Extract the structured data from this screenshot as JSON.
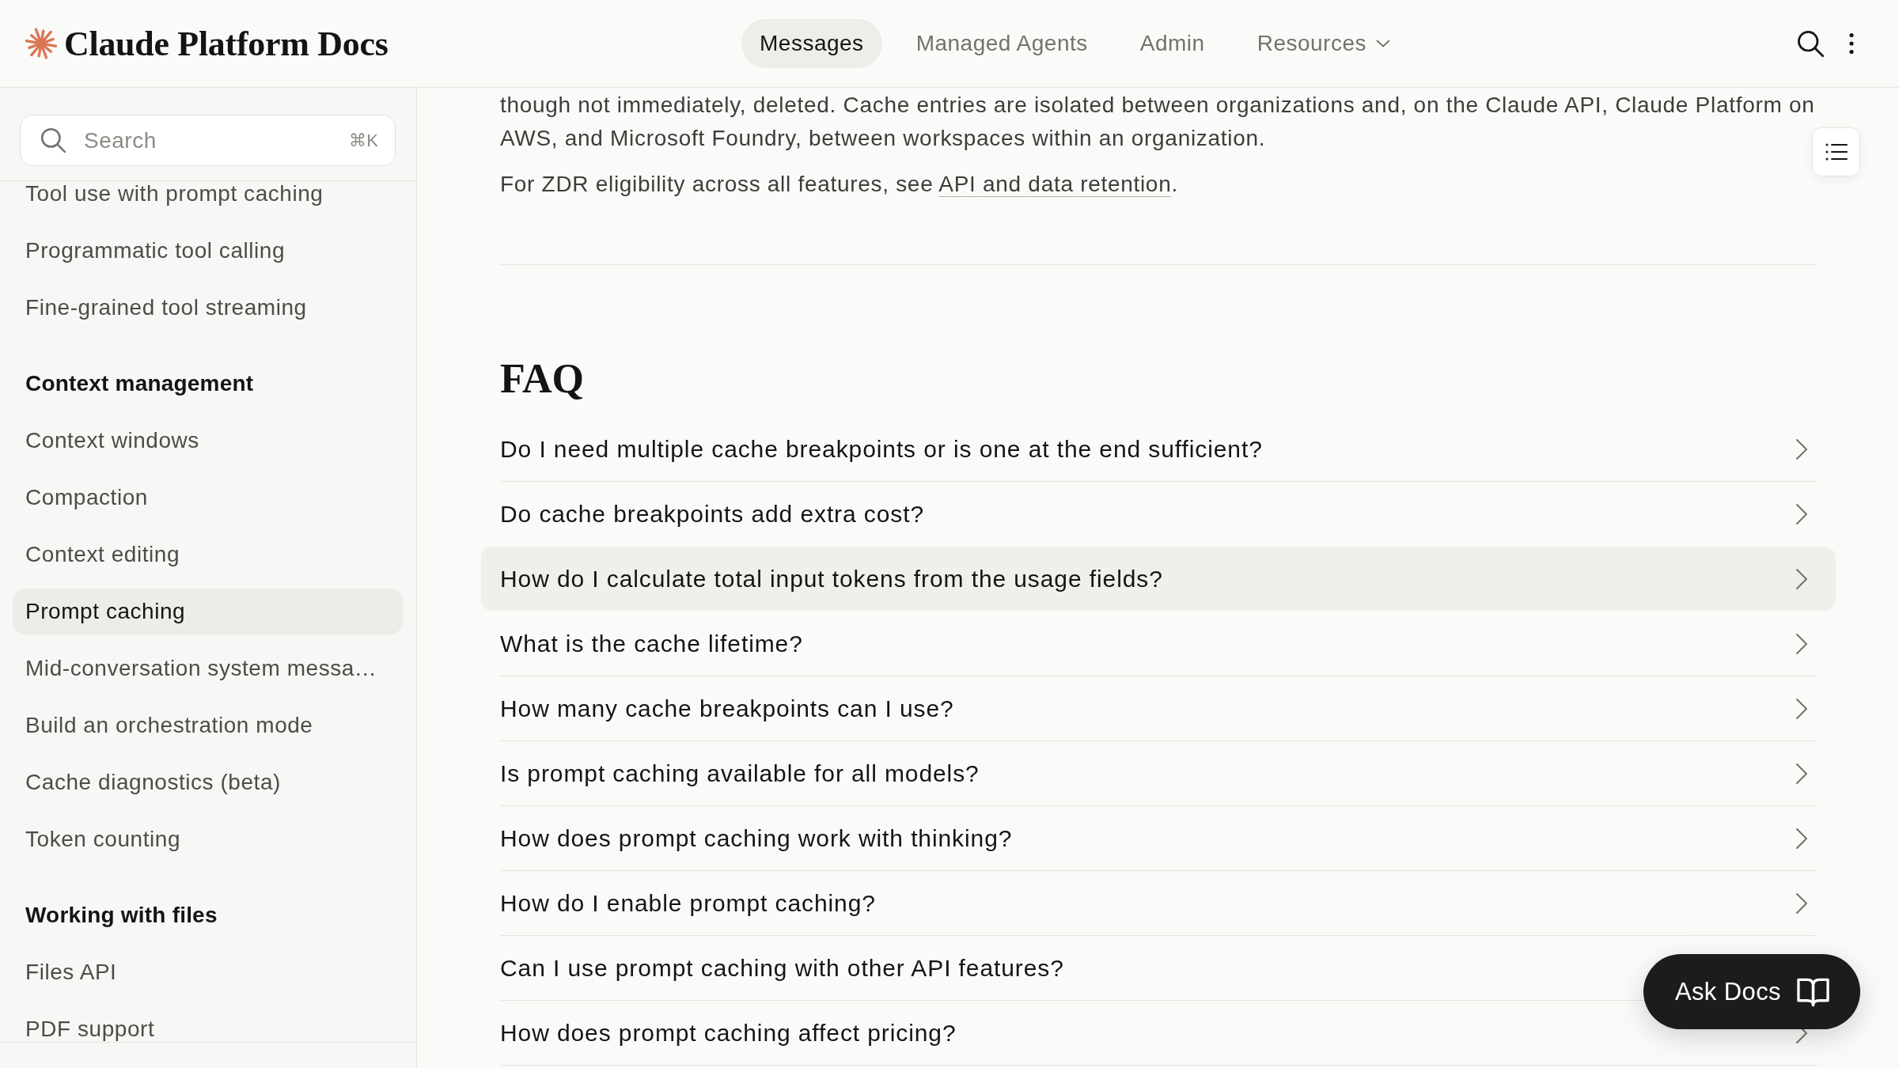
{
  "header": {
    "title": "Claude Platform Docs",
    "nav": [
      {
        "label": "Messages",
        "kind": "link",
        "selected": true
      },
      {
        "label": "Managed Agents",
        "kind": "link",
        "selected": false
      },
      {
        "label": "Admin",
        "kind": "link",
        "selected": false
      },
      {
        "label": "Resources",
        "kind": "dropdown",
        "selected": false
      }
    ]
  },
  "sidebar": {
    "search": {
      "placeholder": "Search",
      "shortcut": "⌘K"
    },
    "sections": [
      {
        "items": [
          {
            "label": "Tool use with prompt caching",
            "selected": false
          },
          {
            "label": "Programmatic tool calling",
            "selected": false
          },
          {
            "label": "Fine-grained tool streaming",
            "selected": false
          }
        ]
      },
      {
        "heading": "Context management",
        "items": [
          {
            "label": "Context windows",
            "selected": false
          },
          {
            "label": "Compaction",
            "selected": false
          },
          {
            "label": "Context editing",
            "selected": false
          },
          {
            "label": "Prompt caching",
            "selected": true
          },
          {
            "label": "Mid-conversation system messa…",
            "selected": false
          },
          {
            "label": "Build an orchestration mode",
            "selected": false
          },
          {
            "label": "Cache diagnostics (beta)",
            "selected": false
          },
          {
            "label": "Token counting",
            "selected": false
          }
        ]
      },
      {
        "heading": "Working with files",
        "items": [
          {
            "label": "Files API",
            "selected": false
          },
          {
            "label": "PDF support",
            "selected": false
          }
        ]
      }
    ]
  },
  "content": {
    "paragraphs": [
      {
        "text": "though not immediately, deleted. Cache entries are isolated between organizations and, on the Claude API, Claude Platform on AWS, and Microsoft Foundry, between workspaces within an organization."
      },
      {
        "text": "For ZDR eligibility across all features, see ",
        "link": "API and data retention",
        "after": "."
      }
    ],
    "faq": {
      "title": "FAQ",
      "questions": [
        {
          "text": "Do I need multiple cache breakpoints or is one at the end sufficient?",
          "hovered": false
        },
        {
          "text": "Do cache breakpoints add extra cost?",
          "hovered": false
        },
        {
          "text": "How do I calculate total input tokens from the usage fields?",
          "hovered": true
        },
        {
          "text": "What is the cache lifetime?",
          "hovered": false
        },
        {
          "text": "How many cache breakpoints can I use?",
          "hovered": false
        },
        {
          "text": "Is prompt caching available for all models?",
          "hovered": false
        },
        {
          "text": "How does prompt caching work with thinking?",
          "hovered": false
        },
        {
          "text": "How do I enable prompt caching?",
          "hovered": false
        },
        {
          "text": "Can I use prompt caching with other API features?",
          "hovered": false
        },
        {
          "text": "How does prompt caching affect pricing?",
          "hovered": false
        }
      ]
    }
  },
  "ask_docs": {
    "label": "Ask Docs"
  }
}
